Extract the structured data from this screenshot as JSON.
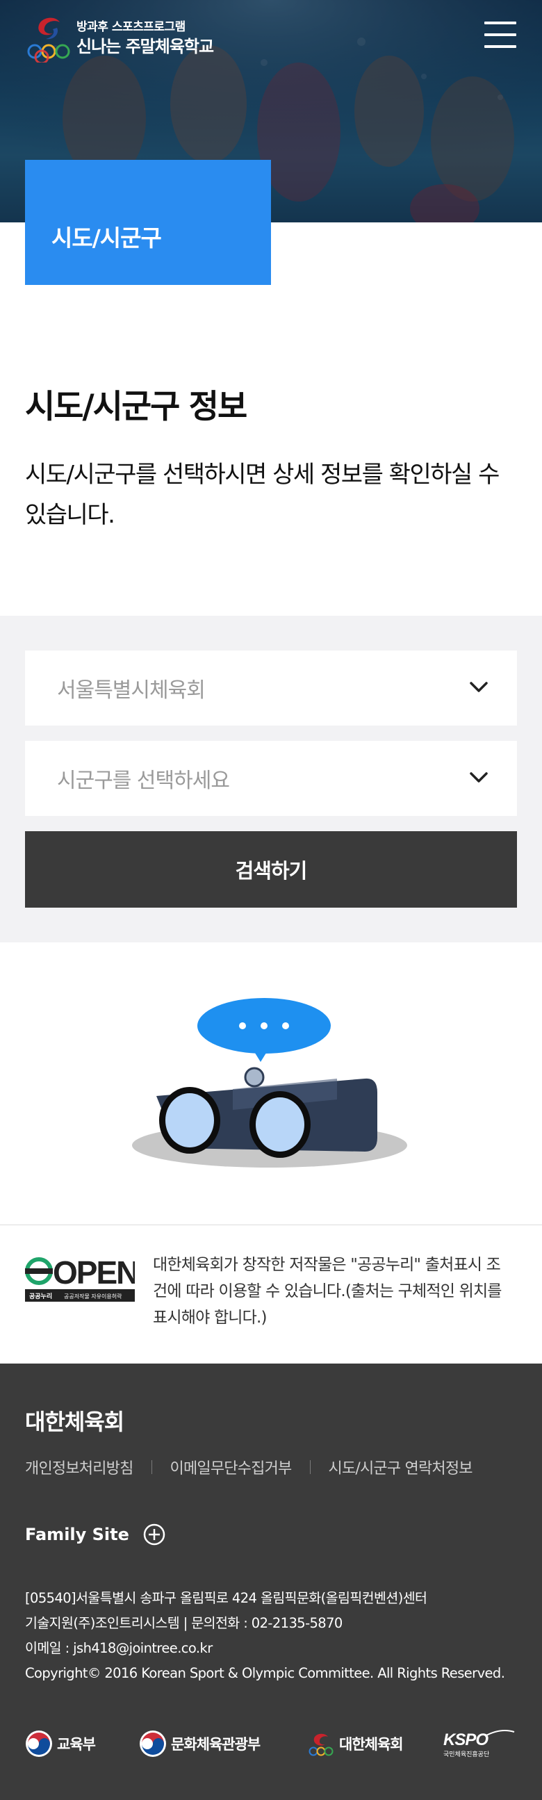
{
  "header": {
    "logo_subtitle": "방과후 스포츠프로그램",
    "logo_title": "신나는 주말체육학교"
  },
  "breadcrumb": {
    "title": "시도/시군구"
  },
  "intro": {
    "title": "시도/시군구 정보",
    "description": "시도/시군구를 선택하시면 상세 정보를 확인하실 수 있습니다."
  },
  "search": {
    "region_select_value": "서울특별시체육회",
    "district_select_placeholder": "시군구를 선택하세요",
    "button_label": "검색하기"
  },
  "license": {
    "logo_word": "OPEN",
    "logo_small_1": "공공누리",
    "logo_small_2": "공공저작물 자유이용허락",
    "text": "대한체육회가 창작한 저작물은 \"공공누리\" 출처표시 조건에 따라 이용할 수 있습니다.(출처는 구체적인 위치를 표시해야 합니다.)"
  },
  "footer": {
    "org_name": "대한체육회",
    "links": [
      "개인정보처리방침",
      "이메일무단수집거부",
      "시도/시군구 연락처정보"
    ],
    "family_site_label": "Family Site",
    "address_lines": [
      "[05540]서울특별시 송파구 올림픽로 424 올림픽문화(올림픽컨벤션)센터",
      "기술지원(주)조인트리시스템 | 문의전화 : 02-2135-5870",
      "이메일 : jsh418@jointree.co.kr",
      " Copyright© 2016 Korean Sport & Olympic Committee. All Rights Reserved."
    ],
    "partner_logos": [
      "교육부",
      "문화체육관광부",
      "대한체육회",
      "KSPO",
      "국민체육진흥공단"
    ]
  },
  "colors": {
    "accent_blue": "#2a8cf0",
    "button_dark": "#3a3a3a",
    "footer_bg": "#3b3b3b",
    "search_bg": "#f2f2f4",
    "speech_bubble": "#1e90f0",
    "binocular_body": "#2f3d55"
  },
  "icons": [
    "logo-mark-icon",
    "menu-icon",
    "chevron-down-icon",
    "binoculars-illustration",
    "open-license-icon",
    "plus-circle-icon"
  ]
}
